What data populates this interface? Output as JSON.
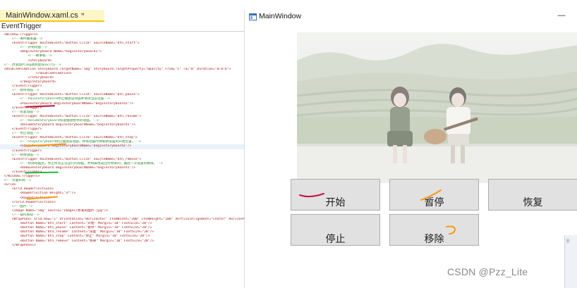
{
  "editor": {
    "file_tab": "MainWindow.xaml.cs",
    "file_tab_pin": "ꟸ",
    "nav_bar": "EventTrigger",
    "code_lines": [
      {
        "text": "  <Window.Triggers>",
        "kind": "tag"
      },
      {
        "text": "      <!--事件触发器-->",
        "kind": "comment"
      },
      {
        "text": "      <EventTrigger RoutedEvent=\"Button.Click\" SourceName=\"btn_start\">",
        "kind": "tag"
      },
      {
        "text": "          <!--开始动画-->",
        "kind": "comment"
      },
      {
        "text": "          <BeginStoryboard Name=\"beginstoryboard1\">",
        "kind": "tag"
      },
      {
        "text": "              <!--故事板-->",
        "kind": "comment"
      },
      {
        "text": "              <Storyboard>",
        "kind": "tag"
      },
      {
        "text": "  <!--改变图片img透明度Opacity-->",
        "kind": "comment"
      },
      {
        "text": "  <DoubleAnimation Storyboard.TargetName=\"img\" Storyboard.TargetProperty=\"Opacity\" From=\"1\" To=\"0\" Duration=\"0:0:6\">",
        "kind": "tag"
      },
      {
        "text": "                  </DoubleAnimation>",
        "kind": "tag"
      },
      {
        "text": "              </Storyboard>",
        "kind": "tag"
      },
      {
        "text": "          </BeginStoryboard>",
        "kind": "tag"
      },
      {
        "text": "      </EventTrigger>",
        "kind": "tag"
      },
      {
        "text": "      <!--暂停动画-->",
        "kind": "comment"
      },
      {
        "text": "      <EventTrigger RoutedEvent=\"Button.Click\" SourceName=\"btn_pause\">",
        "kind": "tag"
      },
      {
        "text": "          <!--PauseStoryboard停止播放该动画并保持当前位置-->",
        "kind": "comment"
      },
      {
        "text": "          <PauseStoryboard BeginStoryboardName=\"beginstoryboard1\"/>",
        "kind": "tag"
      },
      {
        "text": "      </EventTrigger>",
        "kind": "tag"
      },
      {
        "text": "      <!--恢复动画-->",
        "kind": "comment"
      },
      {
        "text": "      <EventTrigger RoutedEvent=\"Button.Click\" SourceName=\"btn_resume\">",
        "kind": "tag"
      },
      {
        "text": "          <!--ResumeStoryboard恢复播放暂停的动画。-->",
        "kind": "comment"
      },
      {
        "text": "          <ResumeStoryboard BeginStoryboardName=\"beginstoryboard1\"/>",
        "kind": "tag"
      },
      {
        "text": "      </EventTrigger>",
        "kind": "tag"
      },
      {
        "text": "      <!--停止动画-->",
        "kind": "comment"
      },
      {
        "text": "      <EventTrigger RoutedEvent=\"Button.Click\" SourceName=\"btn_stop\">",
        "kind": "tag"
      },
      {
        "text": "          <!--StopStoryboard停止播放该动画，并将动画时钟重新设置到开始位置。-->",
        "kind": "comment"
      },
      {
        "text": "          <StopStoryboard BeginStoryboardName=\"beginstoryboard1\"/>",
        "kind": "tag"
      },
      {
        "text": "      </EventTrigger>",
        "kind": "tag"
      },
      {
        "text": "      <!--移除动画-->",
        "kind": "comment"
      },
      {
        "text": "      <EventTrigger RoutedEvent=\"Button.Click\" SourceName=\"btn_remove\">",
        "kind": "tag"
      },
      {
        "text": "          <!--移除动画后，停止所有正在运行的动画，并将属性返回为原来的，最后一次设置的数值。-->",
        "kind": "comment"
      },
      {
        "text": "          <RemoveStoryboard BeginStoryboardName=\"beginstoryboard1\"/>",
        "kind": "tag"
      },
      {
        "text": "      </EventTrigger>",
        "kind": "tag"
      },
      {
        "text": "  </Window.Triggers>",
        "kind": "tag"
      },
      {
        "text": "  <!--页面布局-->",
        "kind": "comment"
      },
      {
        "text": "  <Grid>",
        "kind": "tag"
      },
      {
        "text": "      <Grid.RowDefinitions>",
        "kind": "tag"
      },
      {
        "text": "          <RowDefinition Height=\"3*\"/>",
        "kind": "tag"
      },
      {
        "text": "          <RowDefinition/>",
        "kind": "tag"
      },
      {
        "text": "      </Grid.RowDefinitions>",
        "kind": "tag"
      },
      {
        "text": "      <!--图片-->",
        "kind": "comment"
      },
      {
        "text": "      <Image Name=\"img\" Source=\"Images/原来的图片.jpg\"/>",
        "kind": "tag"
      },
      {
        "text": "      <!--操作按钮-->",
        "kind": "comment"
      },
      {
        "text": "      <WrapPanel Grid.Row=\"1\" Orientation=\"Horizontal\" ItemWidth=\"200\" ItemHeight=\"100\" VerticalAlignment=\"Center\" HorizontalAlignment=\"Center\">",
        "kind": "tag"
      },
      {
        "text": "          <Button Name=\"btn_start\" Content=\"开始\" Margin=\"10\" FontSize=\"20\"/>",
        "kind": "tag"
      },
      {
        "text": "          <Button Name=\"btn_pause\" Content=\"暂停\" Margin=\"10\" FontSize=\"20\"/>",
        "kind": "tag"
      },
      {
        "text": "          <Button Name=\"btn_resume\" Content=\"恢复\" Margin=\"10\" FontSize=\"20\"/>",
        "kind": "tag"
      },
      {
        "text": "          <Button Name=\"btn_stop\" Content=\"停止\" Margin=\"10\" FontSize=\"20\"/>",
        "kind": "tag"
      },
      {
        "text": "          <Button Name=\"btn_remove\" Content=\"移除\" Margin=\"10\" FontSize=\"20\"/>",
        "kind": "tag"
      },
      {
        "text": "      </WrapPanel>",
        "kind": "tag"
      }
    ],
    "highlighted_line": 26,
    "annotation_colors": {
      "red": "#c0143c",
      "orange": "#f39c12",
      "green": "#1fb83f"
    }
  },
  "app_window": {
    "title": "MainWindow",
    "minimize_glyph": "—",
    "buttons": {
      "start": "开始",
      "pause": "暂停",
      "resume": "恢复",
      "stop": "停止",
      "remove": "移除"
    },
    "button_bg": "#e1e1e1",
    "button_border": "#adadad"
  },
  "watermark": "CSDN @Pzz_Lite",
  "right_edge_text": "全"
}
